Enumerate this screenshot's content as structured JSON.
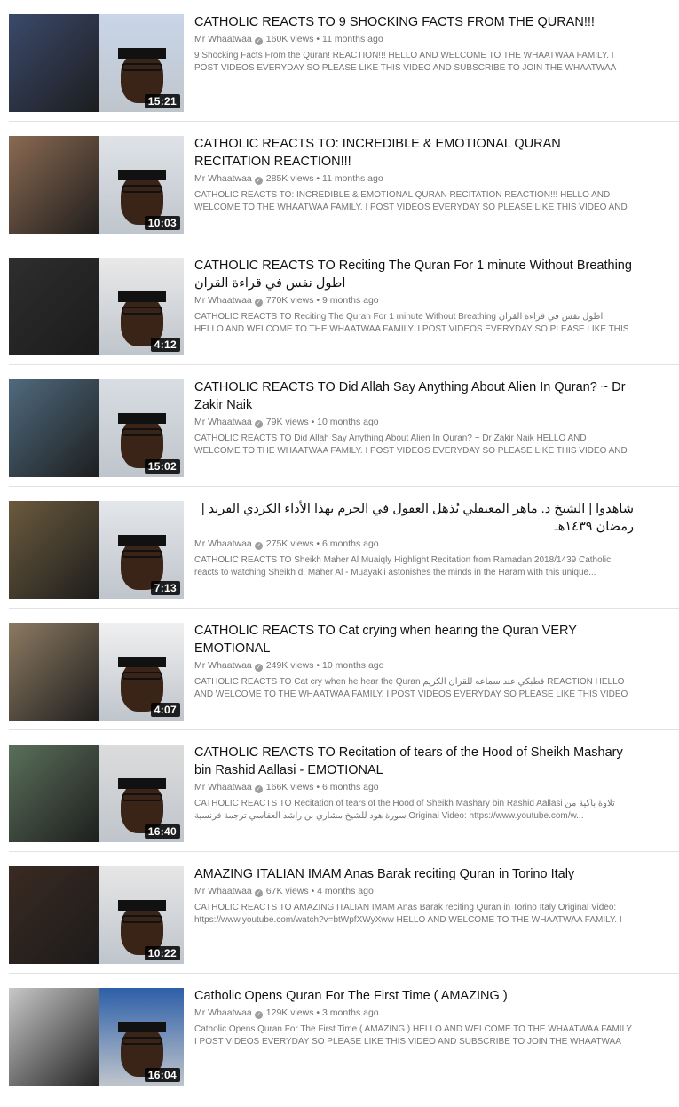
{
  "colors": {
    "title_text": "#111111",
    "meta_text": "#757575",
    "separator": "#e2e2e2",
    "duration_bg": "#000000"
  },
  "videos": [
    {
      "title": "CATHOLIC REACTS TO 9 SHOCKING FACTS FROM THE QURAN!!!",
      "channel": "Mr Whaatwaa",
      "verified_icon": "verified-check-icon",
      "views": "160K views",
      "separator": "•",
      "age": "11 months ago",
      "description": "9 Shocking Facts From the Quran! REACTION!!! HELLO AND WELCOME TO THE WHAATWAA FAMILY. I POST VIDEOS EVERYDAY SO PLEASE LIKE THIS VIDEO AND SUBSCRIBE TO JOIN THE WHAATWAA FAMILY.",
      "duration": "15:21",
      "thumb_colors": [
        "#3b4a6b",
        "#c9d6e8"
      ]
    },
    {
      "title": "CATHOLIC REACTS TO: INCREDIBLE & EMOTIONAL QURAN RECITATION REACTION!!!",
      "channel": "Mr Whaatwaa",
      "verified_icon": "verified-check-icon",
      "views": "285K views",
      "separator": "•",
      "age": "11 months ago",
      "description": "CATHOLIC REACTS TO: INCREDIBLE & EMOTIONAL QURAN RECITATION REACTION!!! HELLO AND WELCOME TO THE WHAATWAA FAMILY. I POST VIDEOS EVERYDAY SO PLEASE LIKE THIS VIDEO AND",
      "duration": "10:03",
      "thumb_colors": [
        "#8a6a52",
        "#dfe3e8"
      ]
    },
    {
      "title": "CATHOLIC REACTS TO Reciting The Quran For 1 minute Without Breathing اطول نفس في قراءة القران",
      "channel": "Mr Whaatwaa",
      "verified_icon": "verified-check-icon",
      "views": "770K views",
      "separator": "•",
      "age": "9 months ago",
      "description": "CATHOLIC REACTS TO Reciting The Quran For 1 minute Without Breathing اطول نفس في قراءة القران HELLO AND WELCOME TO THE WHAATWAA FAMILY. I POST VIDEOS EVERYDAY SO PLEASE LIKE THIS VIDEO AND",
      "duration": "4:12",
      "thumb_colors": [
        "#2e2e2e",
        "#e9e9e9"
      ]
    },
    {
      "title": "CATHOLIC REACTS TO Did Allah Say Anything About Alien In Quran? ~ Dr Zakir Naik",
      "channel": "Mr Whaatwaa",
      "verified_icon": "verified-check-icon",
      "views": "79K views",
      "separator": "•",
      "age": "10 months ago",
      "description": "CATHOLIC REACTS TO Did Allah Say Anything About Alien In Quran? ~ Dr Zakir Naik HELLO AND WELCOME TO THE WHAATWAA FAMILY. I POST VIDEOS EVERYDAY SO PLEASE LIKE THIS VIDEO AND SUBSCRIBE TO",
      "duration": "15:02",
      "thumb_colors": [
        "#4f6a7e",
        "#d8dde2"
      ]
    },
    {
      "title": "شاهدوا | الشيخ د. ماهر المعيقلي يُذهل العقول في الحرم بهذا الأداء الكردي الفريد | رمضان ١٤٣٩هـ",
      "channel": "Mr Whaatwaa",
      "verified_icon": "verified-check-icon",
      "views": "275K views",
      "separator": "•",
      "age": "6 months ago",
      "description": "CATHOLIC REACTS TO Sheikh Maher Al Muaiqly Highlight Recitation from Ramadan 2018/1439 Catholic reacts to watching Sheikh d. Maher Al - Muayakli astonishes the minds in the Haram with this unique...",
      "duration": "7:13",
      "thumb_colors": [
        "#6b5a3e",
        "#e3e6ea"
      ]
    },
    {
      "title": "CATHOLIC REACTS TO Cat crying when hearing the Quran VERY EMOTIONAL",
      "channel": "Mr Whaatwaa",
      "verified_icon": "verified-check-icon",
      "views": "249K views",
      "separator": "•",
      "age": "10 months ago",
      "description": "CATHOLIC REACTS TO Cat cry when he hear the Quran قطبكي عند سماعه للقران الكريم REACTION HELLO AND WELCOME TO THE WHAATWAA FAMILY. I POST VIDEOS EVERYDAY SO PLEASE LIKE THIS VIDEO AND SUBSCRIBE TO JOIN",
      "duration": "4:07",
      "thumb_colors": [
        "#8c7a62",
        "#f0f0f0"
      ]
    },
    {
      "title": "CATHOLIC REACTS TO Recitation of tears of the Hood of Sheikh Mashary bin Rashid Aallasi - EMOTIONAL",
      "channel": "Mr Whaatwaa",
      "verified_icon": "verified-check-icon",
      "views": "166K views",
      "separator": "•",
      "age": "6 months ago",
      "description": "CATHOLIC REACTS TO Recitation of tears of the Hood of Sheikh Mashary bin Rashid Aallasi تلاوة باكية من سورة هود للشيخ مشاري بن راشد العفاسي ترجمة فرنسية Original Video: https://www.youtube.com/w...",
      "duration": "16:40",
      "thumb_colors": [
        "#5a6f5a",
        "#dcdcdc"
      ]
    },
    {
      "title": "AMAZING ITALIAN IMAM Anas Barak reciting Quran in Torino Italy",
      "channel": "Mr Whaatwaa",
      "verified_icon": "verified-check-icon",
      "views": "67K views",
      "separator": "•",
      "age": "4 months ago",
      "description": "CATHOLIC REACTS TO AMAZING ITALIAN IMAM Anas Barak reciting Quran in Torino Italy Original Video: https://www.youtube.com/watch?v=btWpfXWyXww HELLO AND WELCOME TO THE WHAATWAA FAMILY. I",
      "duration": "10:22",
      "thumb_colors": [
        "#3a2a22",
        "#e6e6e6"
      ]
    },
    {
      "title": "Catholic Opens Quran For The First Time ( AMAZING )",
      "channel": "Mr Whaatwaa",
      "verified_icon": "verified-check-icon",
      "views": "129K views",
      "separator": "•",
      "age": "3 months ago",
      "description": "Catholic Opens Quran For The First Time ( AMAZING ) HELLO AND WELCOME TO THE WHAATWAA FAMILY. I POST VIDEOS EVERYDAY SO PLEASE LIKE THIS VIDEO AND SUBSCRIBE TO JOIN THE WHAATWAA FAMILY.",
      "duration": "16:04",
      "thumb_colors": [
        "#c8c8c8",
        "#2d5fa8"
      ]
    }
  ]
}
